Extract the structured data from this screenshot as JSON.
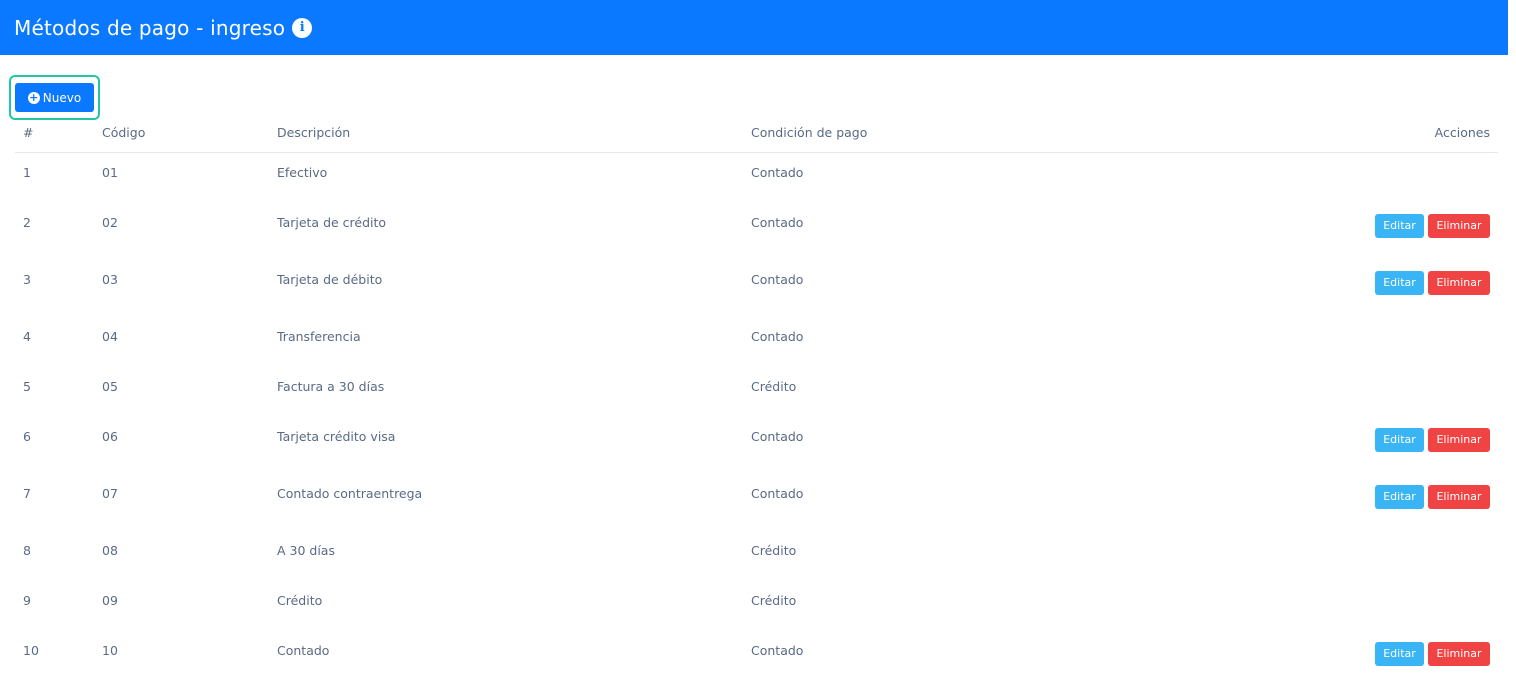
{
  "header": {
    "title": "Métodos de pago - ingreso",
    "info_icon": "info-circle-icon"
  },
  "toolbar": {
    "new_label": "Nuevo",
    "new_icon": "plus-circle-icon"
  },
  "table": {
    "columns": {
      "num": "#",
      "code": "Código",
      "desc": "Descripción",
      "cond": "Condición de pago",
      "actions": "Acciones"
    },
    "edit_label": "Editar",
    "delete_label": "Eliminar",
    "rows": [
      {
        "num": "1",
        "code": "01",
        "desc": "Efectivo",
        "cond": "Contado",
        "actions": false
      },
      {
        "num": "2",
        "code": "02",
        "desc": "Tarjeta de crédito",
        "cond": "Contado",
        "actions": true
      },
      {
        "num": "3",
        "code": "03",
        "desc": "Tarjeta de débito",
        "cond": "Contado",
        "actions": true
      },
      {
        "num": "4",
        "code": "04",
        "desc": "Transferencia",
        "cond": "Contado",
        "actions": false
      },
      {
        "num": "5",
        "code": "05",
        "desc": "Factura a 30 días",
        "cond": "Crédito",
        "actions": false
      },
      {
        "num": "6",
        "code": "06",
        "desc": "Tarjeta crédito visa",
        "cond": "Contado",
        "actions": true
      },
      {
        "num": "7",
        "code": "07",
        "desc": "Contado contraentrega",
        "cond": "Contado",
        "actions": true
      },
      {
        "num": "8",
        "code": "08",
        "desc": "A 30 días",
        "cond": "Crédito",
        "actions": false
      },
      {
        "num": "9",
        "code": "09",
        "desc": "Crédito",
        "cond": "Crédito",
        "actions": false
      },
      {
        "num": "10",
        "code": "10",
        "desc": "Contado",
        "cond": "Contado",
        "actions": true
      }
    ]
  },
  "colors": {
    "primary": "#0a78ff",
    "edit": "#39b4f4",
    "delete": "#f04444",
    "focus_ring": "#21c7a4"
  }
}
